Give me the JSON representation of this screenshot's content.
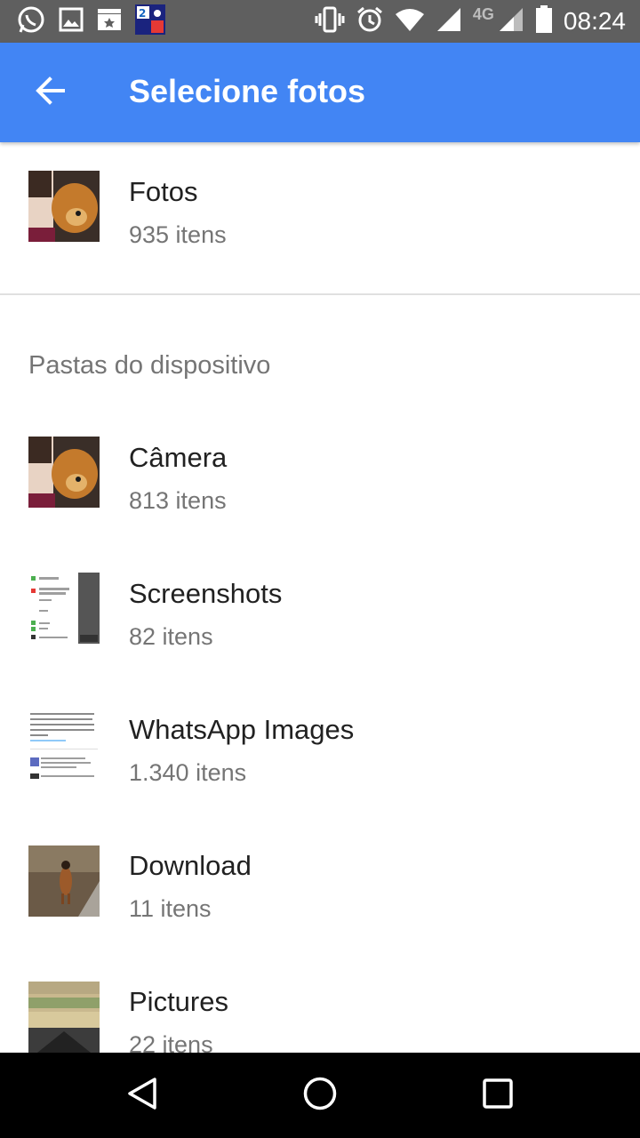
{
  "status_bar": {
    "time": "08:24",
    "network": "4G",
    "icons_left": [
      "whatsapp-icon",
      "gallery-icon",
      "clapperboard-icon",
      "app-icon"
    ],
    "icons_right": [
      "vibrate-icon",
      "alarm-icon",
      "wifi-icon",
      "signal-icon",
      "signal-icon",
      "battery-icon"
    ]
  },
  "app_bar": {
    "title": "Selecione fotos",
    "back_icon": "arrow-back-icon",
    "color": "#4285f4"
  },
  "primary": {
    "title": "Fotos",
    "subtitle": "935 itens"
  },
  "section": {
    "header": "Pastas do dispositivo"
  },
  "folders": [
    {
      "title": "Câmera",
      "subtitle": "813 itens"
    },
    {
      "title": "Screenshots",
      "subtitle": "82 itens"
    },
    {
      "title": "WhatsApp Images",
      "subtitle": "1.340 itens"
    },
    {
      "title": "Download",
      "subtitle": "11 itens"
    },
    {
      "title": "Pictures",
      "subtitle": "22 itens"
    }
  ],
  "nav_bar": {
    "icons": [
      "back-triangle-icon",
      "home-circle-icon",
      "recents-square-icon"
    ]
  }
}
